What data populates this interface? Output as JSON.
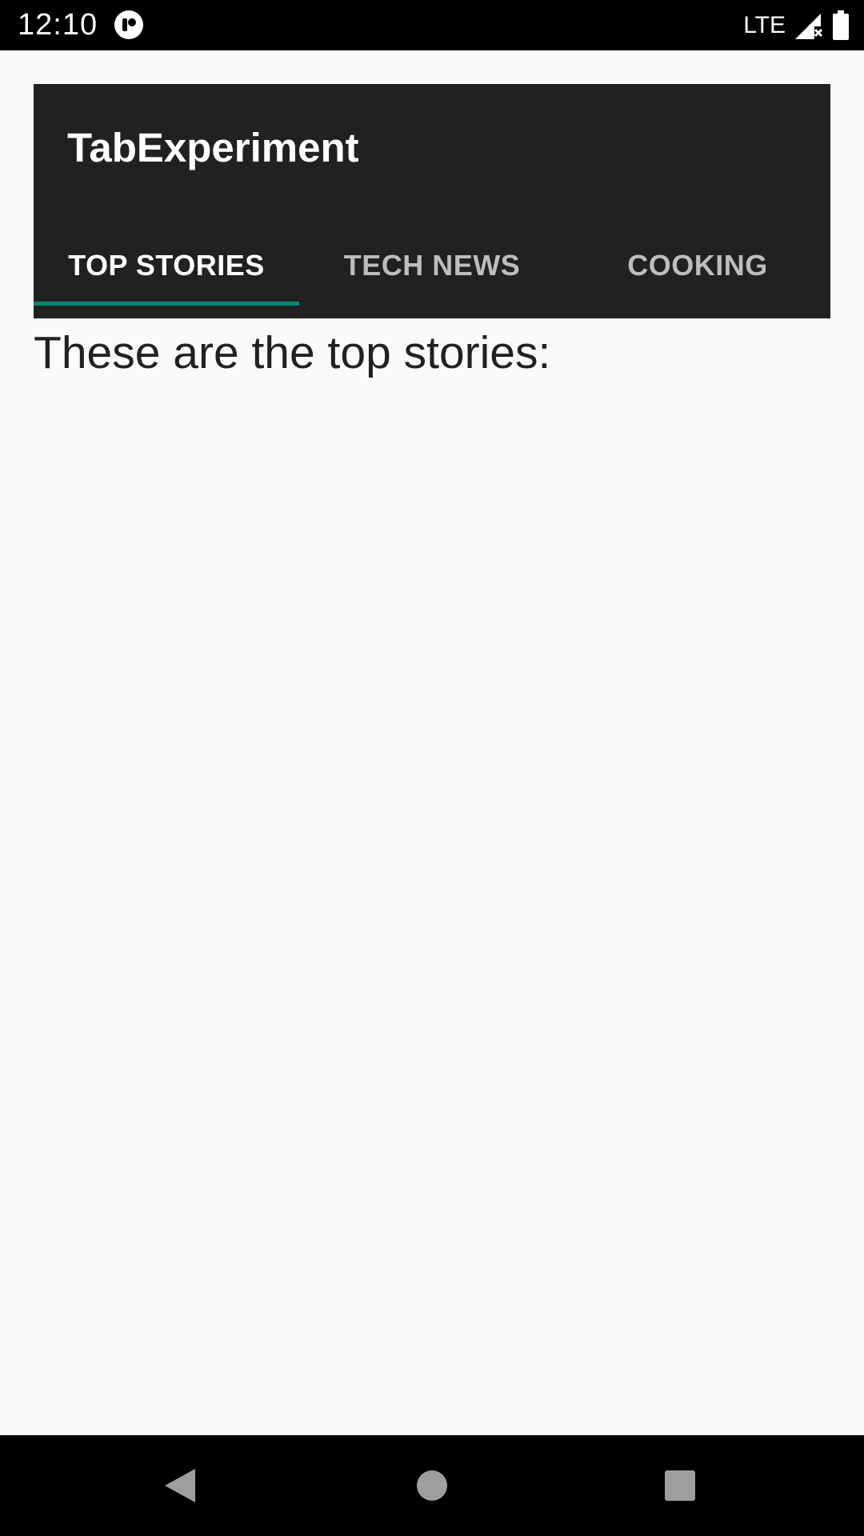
{
  "status_bar": {
    "time": "12:10",
    "network": "LTE",
    "icons": [
      "app-notification-icon",
      "signal-icon",
      "battery-icon"
    ]
  },
  "app_bar": {
    "title": "TabExperiment",
    "background": "#212121"
  },
  "tabs": [
    {
      "label": "TOP STORIES",
      "selected": true
    },
    {
      "label": "TECH NEWS",
      "selected": false
    },
    {
      "label": "COOKING",
      "selected": false
    }
  ],
  "indicator_color": "#00897b",
  "content": {
    "text": "These are the top stories:"
  },
  "nav_bar": {
    "icons": [
      "back-icon",
      "home-icon",
      "recents-icon"
    ]
  }
}
